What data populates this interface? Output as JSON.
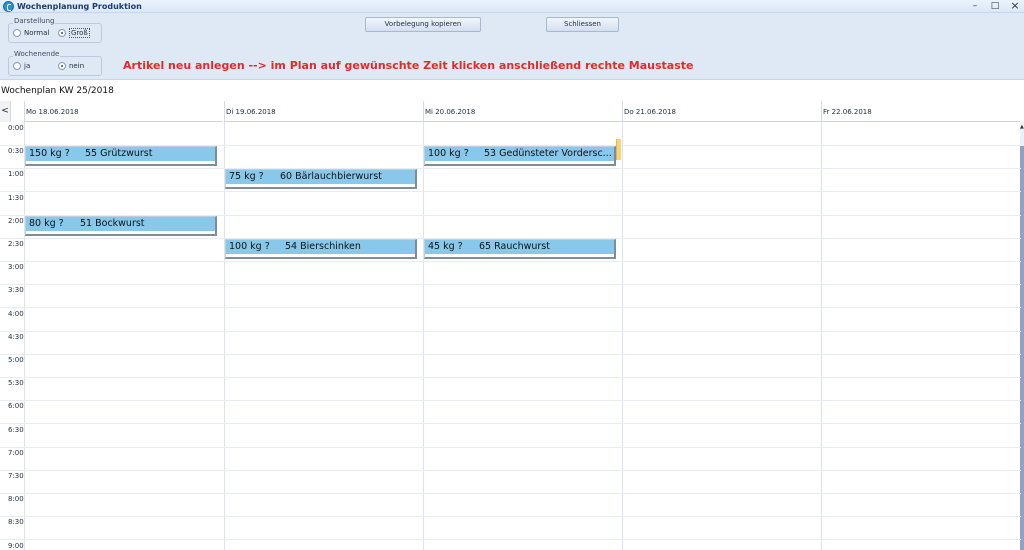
{
  "window": {
    "title": "Wochenplanung Produktion",
    "controls": {
      "minimize": "–",
      "maximize": "□",
      "close": "×"
    }
  },
  "toolbar": {
    "darstellung": {
      "label": "Darstellung",
      "options": [
        "Normal",
        "Groß"
      ],
      "selected": "Groß"
    },
    "wochenende": {
      "label": "Wochenende",
      "options": [
        "ja",
        "nein"
      ],
      "selected": "nein"
    },
    "vorbelegung_label": "Vorbelegung kopieren",
    "schliessen_label": "Schliessen",
    "hint": "Artikel neu anlegen --> im Plan auf gewünschte Zeit klicken anschließend rechte  Maustaste"
  },
  "plan": {
    "title": "Wochenplan KW 25/2018",
    "nav_prev": "<",
    "days": [
      "Mo 18.06.2018",
      "Di 19.06.2018",
      "Mi 20.06.2018",
      "Do 21.06.2018",
      "Fr 22.06.2018"
    ],
    "times": [
      "0:00",
      "0:30",
      "1:00",
      "1:30",
      "2:00",
      "2:30",
      "3:00",
      "3:30",
      "4:00",
      "4:30",
      "5:00",
      "5:30",
      "6:00",
      "6:30",
      "7:00",
      "7:30",
      "8:00",
      "8:30",
      "9:00"
    ],
    "events": [
      {
        "day": 0,
        "slot": 1,
        "kg": "150 kg ?",
        "name": "55 Grützwurst"
      },
      {
        "day": 1,
        "slot": 2,
        "kg": "75 kg ?",
        "name": "60 Bärlauchbierwurst"
      },
      {
        "day": 2,
        "slot": 1,
        "kg": "100 kg ?",
        "name": "53 Gedünsteter Vordersc..."
      },
      {
        "day": 0,
        "slot": 4,
        "kg": "80 kg ?",
        "name": "51 Bockwurst"
      },
      {
        "day": 1,
        "slot": 5,
        "kg": "100 kg ?",
        "name": "54 Bierschinken"
      },
      {
        "day": 2,
        "slot": 5,
        "kg": "45 kg ?",
        "name": "65 Rauchwurst"
      }
    ]
  },
  "colors": {
    "event_bar": "#87c8eb",
    "hint_text": "#e32a2a",
    "panel_bg": "#dfe9f6",
    "selection_marker": "#f7d37a"
  }
}
